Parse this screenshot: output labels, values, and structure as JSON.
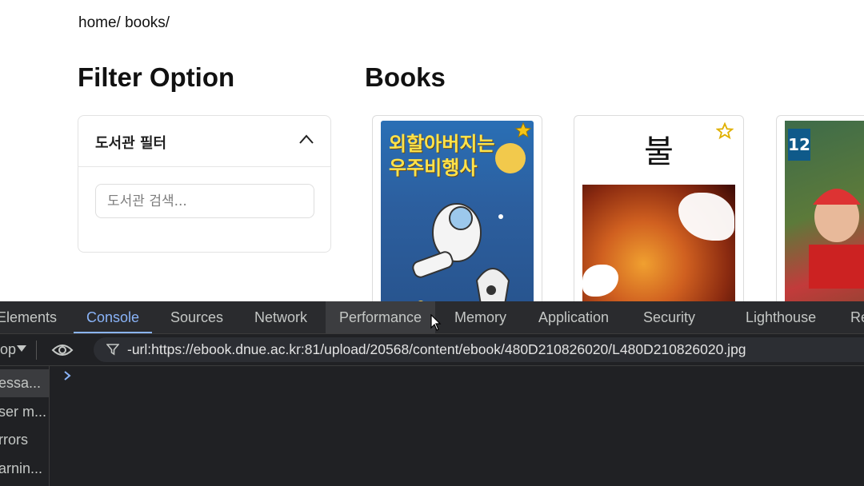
{
  "breadcrumb": "home/ books/",
  "filter_panel": {
    "heading": "Filter Option",
    "section_title": "도서관 필터",
    "search_placeholder": "도서관 검색..."
  },
  "books": {
    "heading": "Books",
    "items": [
      {
        "title_line1": "외할아버지는",
        "title_line2": "우주비행사"
      },
      {
        "title": "불"
      },
      {
        "number": "12"
      }
    ]
  },
  "devtools": {
    "tabs": [
      "Elements",
      "Console",
      "Sources",
      "Network",
      "Performance",
      "Memory",
      "Application",
      "Security",
      "Lighthouse",
      "Re"
    ],
    "active_tab": "Console",
    "context": "op",
    "filter": "-url:https://ebook.dnue.ac.kr:81/upload/20568/content/ebook/480D210826020/L480D210826020.jpg",
    "sidebar": [
      "essa...",
      "ser m...",
      "rrors",
      "arnin..."
    ]
  },
  "colors": {
    "accent": "#8ab4f8",
    "devtools_bg": "#202124",
    "star": "#f5c518"
  }
}
